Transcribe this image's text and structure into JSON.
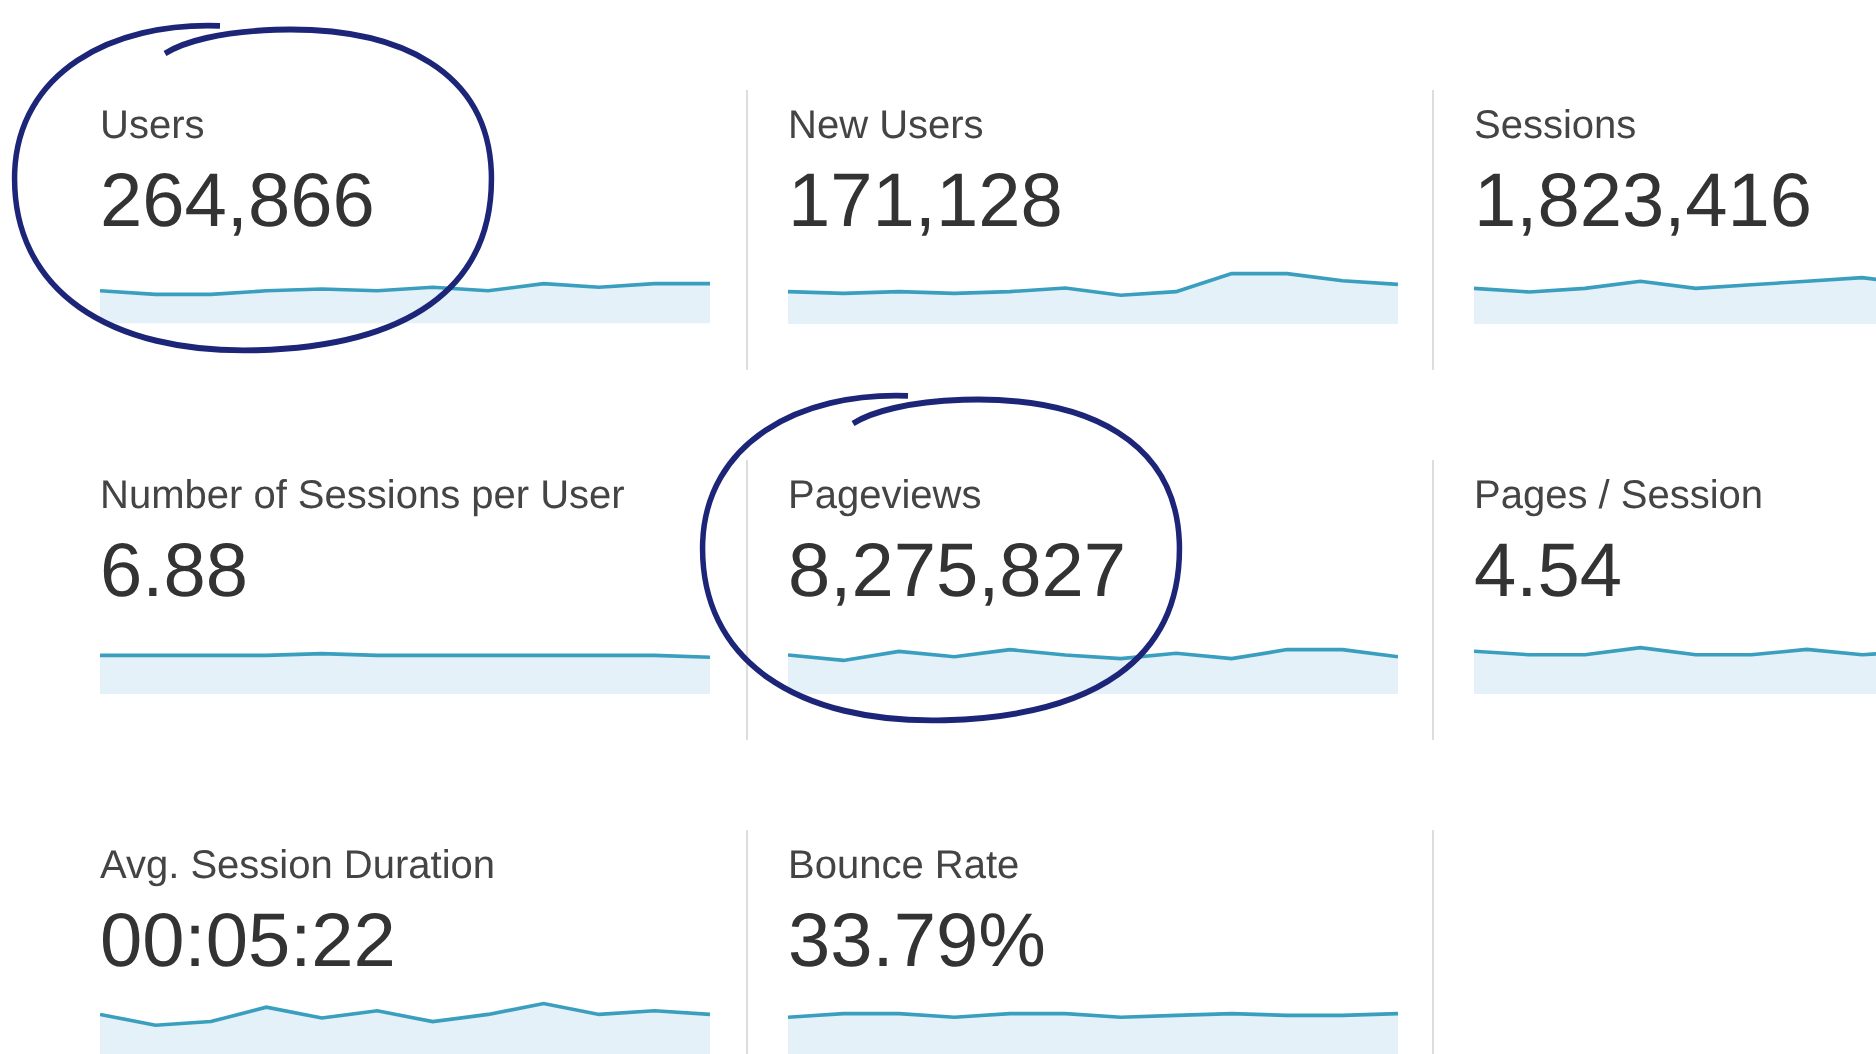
{
  "metrics": [
    {
      "label": "Users",
      "value": "264,866",
      "circled": true
    },
    {
      "label": "New Users",
      "value": "171,128",
      "circled": false
    },
    {
      "label": "Sessions",
      "value": "1,823,416",
      "circled": false
    },
    {
      "label": "Number of Sessions per User",
      "value": "6.88",
      "circled": false
    },
    {
      "label": "Pageviews",
      "value": "8,275,827",
      "circled": true
    },
    {
      "label": "Pages / Session",
      "value": "4.54",
      "circled": false
    },
    {
      "label": "Avg. Session Duration",
      "value": "00:05:22",
      "circled": false
    },
    {
      "label": "Bounce Rate",
      "value": "33.79%",
      "circled": false
    }
  ]
}
